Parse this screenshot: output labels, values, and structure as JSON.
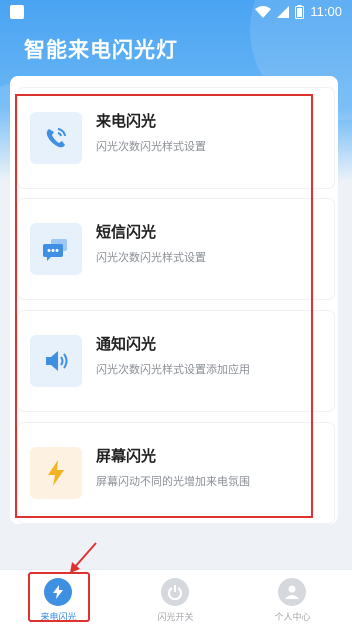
{
  "status_bar": {
    "time": "11:00"
  },
  "app": {
    "title": "智能来电闪光灯"
  },
  "features": [
    {
      "title": "来电闪光",
      "subtitle": "闪光次数闪光样式设置",
      "icon": "phone-call-icon"
    },
    {
      "title": "短信闪光",
      "subtitle": "闪光次数闪光样式设置",
      "icon": "message-icon"
    },
    {
      "title": "通知闪光",
      "subtitle": "闪光次数闪光样式设置添加应用",
      "icon": "speaker-icon"
    },
    {
      "title": "屏幕闪光",
      "subtitle": "屏幕闪动不同的光增加来电氛围",
      "icon": "lightning-icon"
    }
  ],
  "tabs": [
    {
      "label": "来电闪光",
      "icon": "lightning-icon",
      "active": true
    },
    {
      "label": "闪光开关",
      "icon": "power-icon",
      "active": false
    },
    {
      "label": "个人中心",
      "icon": "user-icon",
      "active": false
    }
  ],
  "colors": {
    "accent": "#2f86e6",
    "highlight": "#e03131",
    "header": "#4aa3f2"
  }
}
